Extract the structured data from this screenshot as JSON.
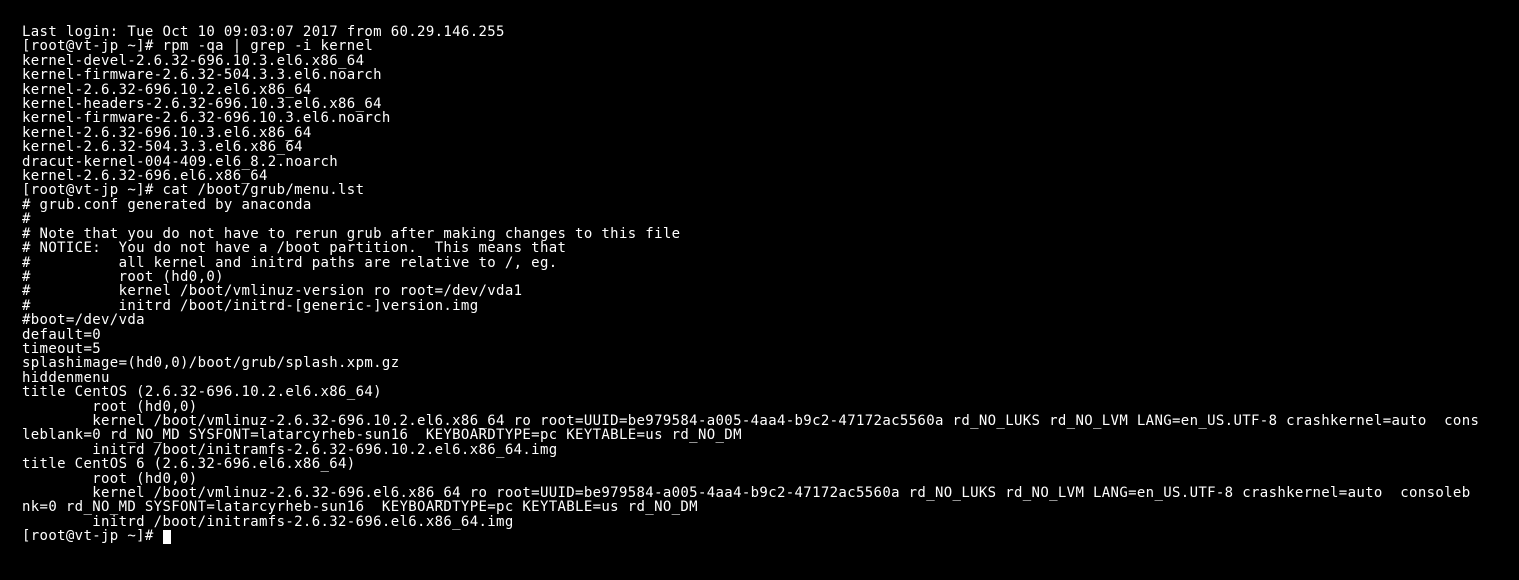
{
  "terminal": {
    "lines": [
      "Last login: Tue Oct 10 09:03:07 2017 from 60.29.146.255",
      "[root@vt-jp ~]# rpm -qa | grep -i kernel",
      "kernel-devel-2.6.32-696.10.3.el6.x86_64",
      "kernel-firmware-2.6.32-504.3.3.el6.noarch",
      "kernel-2.6.32-696.10.2.el6.x86_64",
      "kernel-headers-2.6.32-696.10.3.el6.x86_64",
      "kernel-firmware-2.6.32-696.10.3.el6.noarch",
      "kernel-2.6.32-696.10.3.el6.x86_64",
      "kernel-2.6.32-504.3.3.el6.x86_64",
      "dracut-kernel-004-409.el6_8.2.noarch",
      "kernel-2.6.32-696.el6.x86_64",
      "[root@vt-jp ~]# cat /boot/grub/menu.lst",
      "# grub.conf generated by anaconda",
      "#",
      "# Note that you do not have to rerun grub after making changes to this file",
      "# NOTICE:  You do not have a /boot partition.  This means that",
      "#          all kernel and initrd paths are relative to /, eg.",
      "#          root (hd0,0)",
      "#          kernel /boot/vmlinuz-version ro root=/dev/vda1",
      "#          initrd /boot/initrd-[generic-]version.img",
      "#boot=/dev/vda",
      "default=0",
      "timeout=5",
      "splashimage=(hd0,0)/boot/grub/splash.xpm.gz",
      "hiddenmenu",
      "title CentOS (2.6.32-696.10.2.el6.x86_64)",
      "        root (hd0,0)",
      "        kernel /boot/vmlinuz-2.6.32-696.10.2.el6.x86_64 ro root=UUID=be979584-a005-4aa4-b9c2-47172ac5560a rd_NO_LUKS rd_NO_LVM LANG=en_US.UTF-8 crashkernel=auto  cons",
      "leblank=0 rd_NO_MD SYSFONT=latarcyrheb-sun16  KEYBOARDTYPE=pc KEYTABLE=us rd_NO_DM",
      "        initrd /boot/initramfs-2.6.32-696.10.2.el6.x86_64.img",
      "title CentOS 6 (2.6.32-696.el6.x86_64)",
      "        root (hd0,0)",
      "        kernel /boot/vmlinuz-2.6.32-696.el6.x86_64 ro root=UUID=be979584-a005-4aa4-b9c2-47172ac5560a rd_NO_LUKS rd_NO_LVM LANG=en_US.UTF-8 crashkernel=auto  consoleb",
      "nk=0 rd_NO_MD SYSFONT=latarcyrheb-sun16  KEYBOARDTYPE=pc KEYTABLE=us rd_NO_DM",
      "        initrd /boot/initramfs-2.6.32-696.el6.x86_64.img",
      "[root@vt-jp ~]# "
    ]
  }
}
